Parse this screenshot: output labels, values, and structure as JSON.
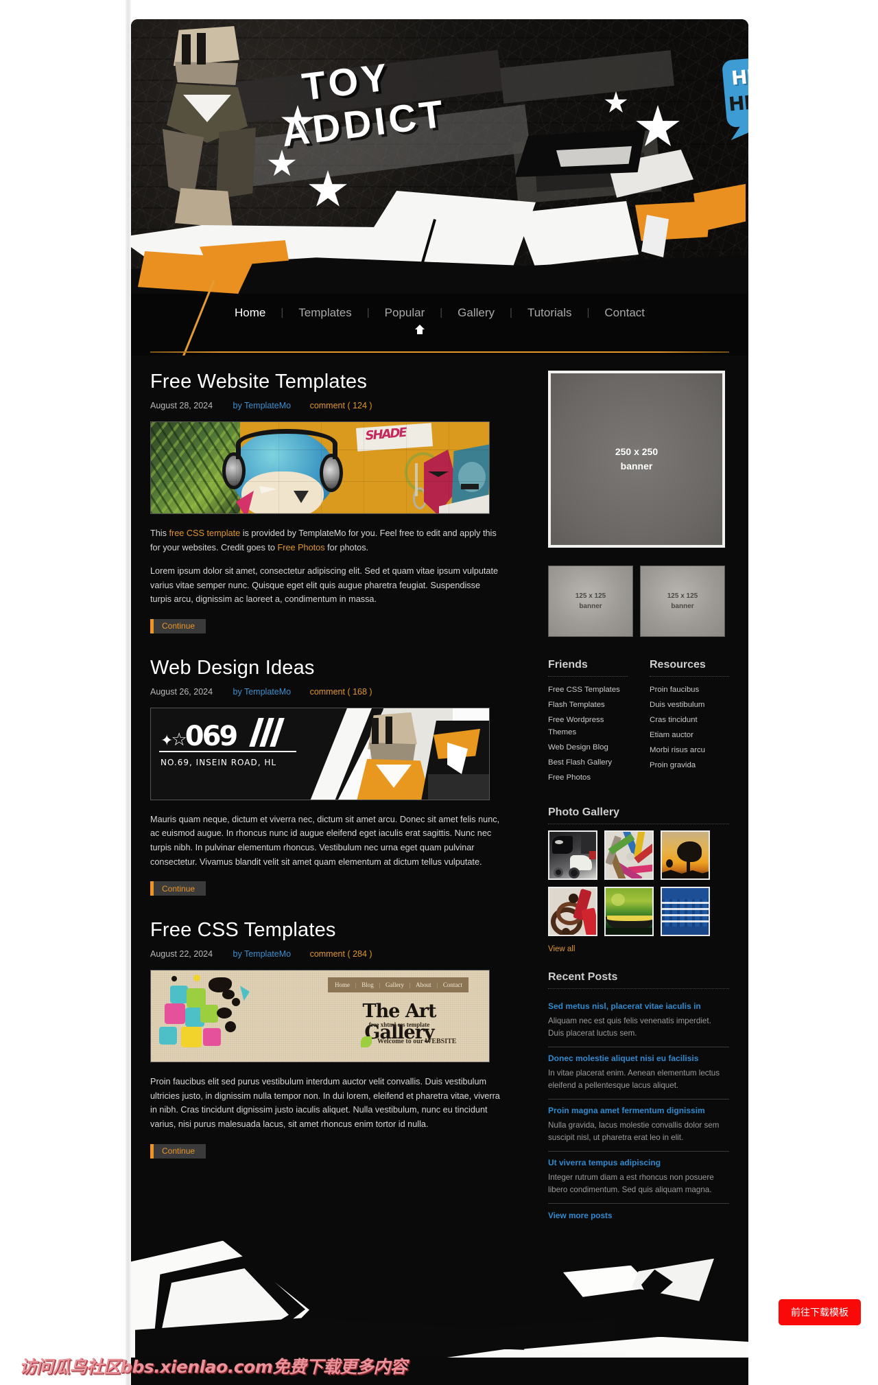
{
  "site": {
    "logo_line1": "TOY",
    "logo_line2": "ADDICT",
    "bubble_top": "HELLO!",
    "bubble_bottom": "HELLO!",
    "accent_orange": "#e0962c",
    "accent_blue": "#2f8ace",
    "bubble_blue": "#3c9cd3",
    "bg_dark": "#0a0a0a"
  },
  "nav": {
    "items": [
      {
        "label": "Home",
        "active": true
      },
      {
        "label": "Templates",
        "active": false
      },
      {
        "label": "Popular",
        "active": false
      },
      {
        "label": "Gallery",
        "active": false
      },
      {
        "label": "Tutorials",
        "active": false
      },
      {
        "label": "Contact",
        "active": false
      }
    ],
    "separator": "|"
  },
  "posts": [
    {
      "title": "Free Website Templates",
      "date": "August 28, 2024",
      "by_label": "by",
      "author": "TemplateMo",
      "comment_label": "comment",
      "comment_count": "( 124 )",
      "image_name": "graffiti-headphones-photo",
      "paragraphs": [
        "This free CSS template is provided by TemplateMo for you. Feel free to edit and apply this for your websites. Credit goes to Free Photos for photos.",
        "Lorem ipsum dolor sit amet, consectetur adipiscing elit. Sed et quam vitae ipsum vulputate varius vitae semper nunc. Quisque eget elit quis augue pharetra feugiat. Suspendisse turpis arcu, dignissim ac laoreet a, condimentum in massa."
      ],
      "inline_links": [
        "free CSS template",
        "Free Photos"
      ],
      "continue_label": "Continue"
    },
    {
      "title": "Web Design Ideas",
      "date": "August 26, 2024",
      "by_label": "by",
      "author": "TemplateMo",
      "comment_label": "comment",
      "comment_count": "( 168 )",
      "image_name": "street-sign-69-photo",
      "paragraphs": [
        "Mauris quam neque, dictum et viverra nec, dictum sit amet arcu. Donec sit amet felis nunc, ac euismod augue. In rhoncus nunc id augue eleifend eget iaculis erat sagittis. Nunc nec turpis nibh. In pulvinar elementum rhoncus. Vestibulum nec urna eget quam pulvinar consectetur. Vivamus blandit velit sit amet quam elementum at dictum tellus vulputate."
      ],
      "continue_label": "Continue"
    },
    {
      "title": "Free CSS Templates",
      "date": "August 22, 2024",
      "by_label": "by",
      "author": "TemplateMo",
      "comment_label": "comment",
      "comment_count": "( 284 )",
      "image_name": "art-gallery-template-screenshot",
      "paragraphs": [
        "Proin faucibus elit sed purus vestibulum interdum auctor velit convallis. Duis vestibulum ultricies justo, in dignissim nulla tempor non. In dui lorem, eleifend et pharetra vitae, viverra in nibh. Cras tincidunt dignissim justo iaculis aliquet. Nulla vestibulum, nunc eu tincidunt varius, nisi purus malesuada lacus, sit amet rhoncus enim tortor id nulla."
      ],
      "continue_label": "Continue"
    }
  ],
  "thumbnail_inner": {
    "art_gallery_nav": [
      "Home",
      "Blog",
      "Gallery",
      "About",
      "Contact"
    ],
    "art_gallery_title": "The Art Gallery",
    "art_gallery_sub": "free xhtml css template",
    "art_gallery_welcome": "Welcome to our WEBSITE",
    "sign_number": "69",
    "sign_road": "NO.69, INSEIN ROAD, HL"
  },
  "sidebar": {
    "banner_250": "250 x 250\nbanner",
    "banner_250_line1": "250 x 250",
    "banner_250_line2": "banner",
    "banner_125_a_line1": "125 x 125",
    "banner_125_a_line2": "banner",
    "banner_125_b_line1": "125 x 125",
    "banner_125_b_line2": "banner",
    "friends_title": "Friends",
    "friends": [
      "Free CSS Templates",
      "Flash Templates",
      "Free Wordpress Themes",
      "Web Design Blog",
      "Best Flash Gallery",
      "Free Photos"
    ],
    "resources_title": "Resources",
    "resources": [
      "Proin faucibus",
      "Duis vestibulum",
      "Cras tincidunt",
      "Etiam auctor",
      "Morbi risus arcu",
      "Proin gravida"
    ],
    "gallery_title": "Photo Gallery",
    "gallery_thumbs": [
      "motorcycle-scooter-thumb",
      "colored-pencils-thumb",
      "tree-sunset-thumb",
      "beads-necklace-thumb",
      "green-boat-thumb",
      "harbour-boats-thumb"
    ],
    "view_all": "View all",
    "recent_title": "Recent Posts",
    "recent_posts": [
      {
        "title": "Sed metus nisl, placerat vitae iaculis in",
        "excerpt": "Aliquam nec est quis felis venenatis imperdiet. Duis placerat luctus sem."
      },
      {
        "title": "Donec molestie aliquet nisi eu facilisis",
        "excerpt": "In vitae placerat enim. Aenean elementum lectus eleifend a pellentesque lacus aliquet."
      },
      {
        "title": "Proin magna amet fermentum dignissim",
        "excerpt": "Nulla gravida, lacus molestie convallis dolor sem suscipit nisl, ut pharetra erat leo in elit."
      },
      {
        "title": "Ut viverra tempus adipiscing",
        "excerpt": "Integer rutrum diam a est rhoncus non posuere libero condimentum. Sed quis aliquam magna."
      }
    ],
    "view_more": "View more posts"
  },
  "overlay": {
    "watermark": "访问瓜鸟社区bbs.xienlao.com免费下载更多内容",
    "download_button": "前往下载模板"
  }
}
